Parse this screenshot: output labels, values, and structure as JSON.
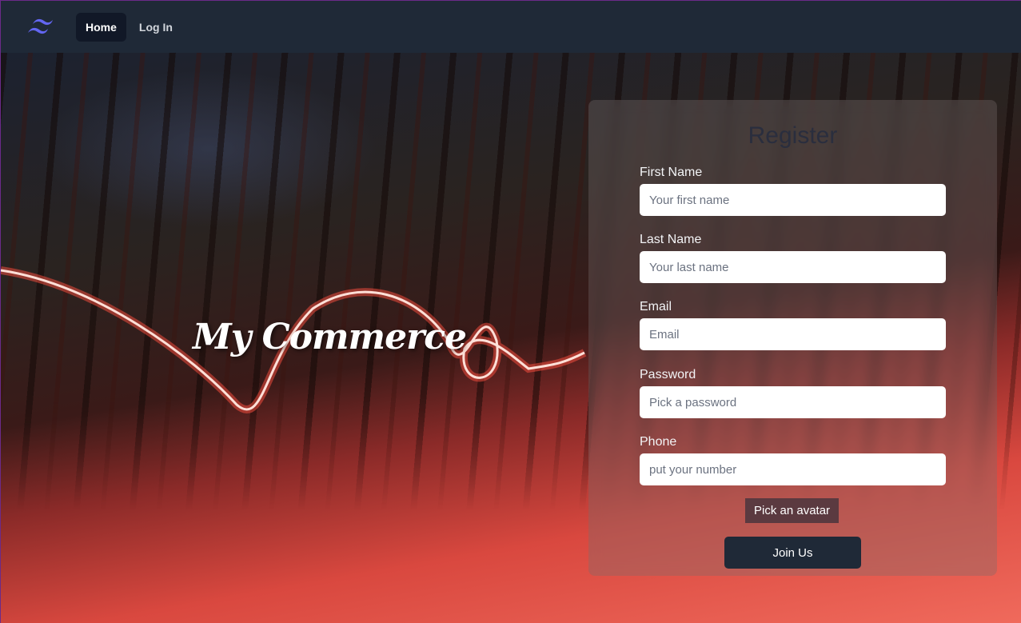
{
  "nav": {
    "home": "Home",
    "login": "Log In"
  },
  "hero": {
    "brand": "My Commerce"
  },
  "form": {
    "title": "Register",
    "fields": [
      {
        "label": "First Name",
        "placeholder": "Your first name"
      },
      {
        "label": "Last Name",
        "placeholder": "Your last name"
      },
      {
        "label": "Email",
        "placeholder": "Email"
      },
      {
        "label": "Password",
        "placeholder": "Pick a password"
      },
      {
        "label": "Phone",
        "placeholder": "put your number"
      }
    ],
    "avatar_button": "Pick an avatar",
    "submit": "Join Us"
  },
  "colors": {
    "nav": "#1f2937",
    "logo": "#6366f1"
  }
}
